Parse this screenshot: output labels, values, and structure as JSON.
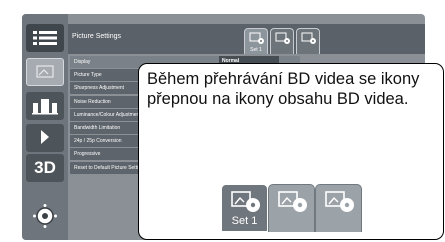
{
  "menu": {
    "title": "Picture Settings",
    "tabs": [
      {
        "icon": "bd-video-settings-icon",
        "label": "Set 1",
        "selected": true
      },
      {
        "icon": "bd-video-settings-icon",
        "label": "",
        "selected": false
      },
      {
        "icon": "bd-video-settings-icon",
        "label": "",
        "selected": false
      }
    ],
    "items": [
      {
        "label": "Display"
      },
      {
        "label": "Picture Type"
      },
      {
        "label": "Sharpness Adjustment"
      },
      {
        "label": "Noise Reduction"
      },
      {
        "label": "Luminance/Colour Adjustment"
      },
      {
        "label": "Bandwidth Limitation"
      },
      {
        "label": "24p / 25p Conversion"
      },
      {
        "label": "Progressive"
      },
      {
        "label": "Reset to Default Picture Settings"
      }
    ],
    "current_value": "Normal"
  },
  "sidebar": {
    "items": [
      {
        "name": "top-menu",
        "icon": "list-icon"
      },
      {
        "name": "picture",
        "icon": "picture-icon"
      },
      {
        "name": "sound",
        "icon": "speaker-icon"
      },
      {
        "name": "music",
        "icon": "music-note-icon"
      },
      {
        "name": "3d",
        "label": "3D"
      }
    ]
  },
  "callout": {
    "text": "Během přehrávání BD videa se ikony přepnou na ikony obsahu BD videa.",
    "tabs": [
      {
        "label": "Set 1",
        "selected": true
      },
      {
        "label": "",
        "selected": false
      },
      {
        "label": "",
        "selected": false
      }
    ]
  },
  "colors": {
    "screen": "#8a9096",
    "sidebar": "#6e757c",
    "row": "#5d646b"
  }
}
